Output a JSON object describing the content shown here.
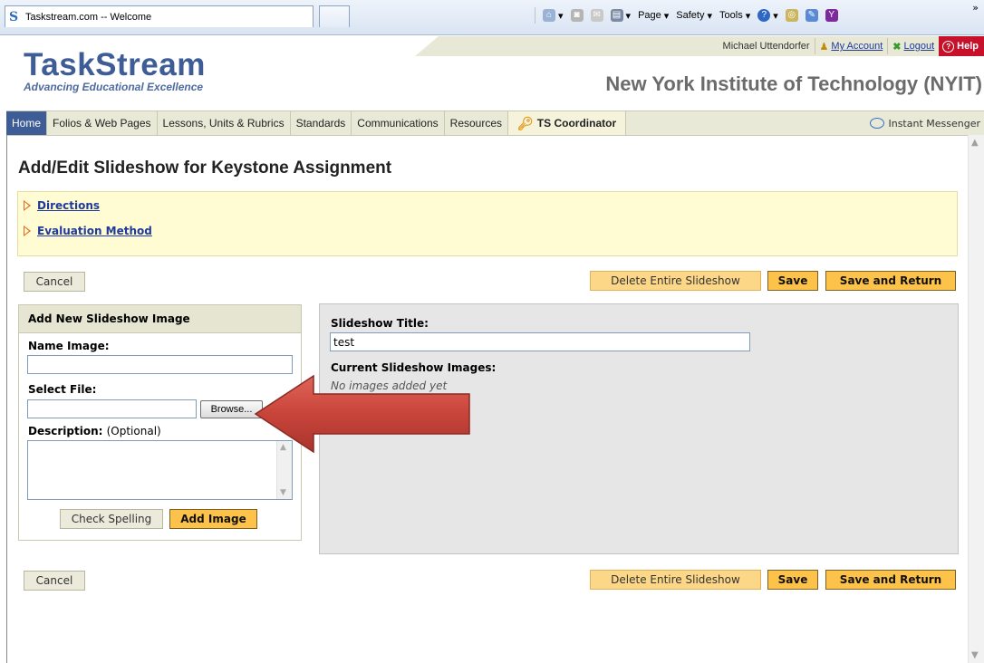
{
  "browser": {
    "tab_title": "Taskstream.com -- Welcome",
    "favicon": "S",
    "commands": {
      "page": "Page",
      "safety": "Safety",
      "tools": "Tools"
    },
    "overflow": "»"
  },
  "header": {
    "user_name": "Michael Uttendorfer",
    "my_account": "My Account",
    "logout": "Logout",
    "help": "Help",
    "logo_word": "TaskStream",
    "logo_tagline": "Advancing Educational Excellence",
    "institution": "New York Institute of Technology (NYIT)"
  },
  "nav": {
    "items": [
      {
        "label": "Home"
      },
      {
        "label": "Folios & Web Pages"
      },
      {
        "label": "Lessons, Units & Rubrics"
      },
      {
        "label": "Standards"
      },
      {
        "label": "Communications"
      },
      {
        "label": "Resources"
      },
      {
        "label": "TS Coordinator"
      }
    ],
    "messenger": "Instant Messenger"
  },
  "page": {
    "title": "Add/Edit Slideshow for Keystone Assignment",
    "directions": "Directions",
    "evaluation_method": "Evaluation Method"
  },
  "actions": {
    "cancel": "Cancel",
    "delete_slideshow": "Delete Entire Slideshow",
    "save": "Save",
    "save_return": "Save and Return"
  },
  "add_image": {
    "heading": "Add New Slideshow Image",
    "name_label": "Name Image:",
    "name_value": "",
    "file_label": "Select File:",
    "file_value": "",
    "browse": "Browse...",
    "description_label": "Description:",
    "description_optional": "(Optional)",
    "check_spelling": "Check Spelling",
    "add_image": "Add Image"
  },
  "slideshow": {
    "title_label": "Slideshow Title:",
    "title_value": "test",
    "current_label": "Current Slideshow Images:",
    "empty_text": "No images added yet"
  },
  "colors": {
    "brand": "#3e5d96",
    "primary_button": "#fdc24a",
    "secondary_button": "#fdd788",
    "info_box": "#fffcd3",
    "help": "#c7102a",
    "arrow": "#c8443a"
  }
}
